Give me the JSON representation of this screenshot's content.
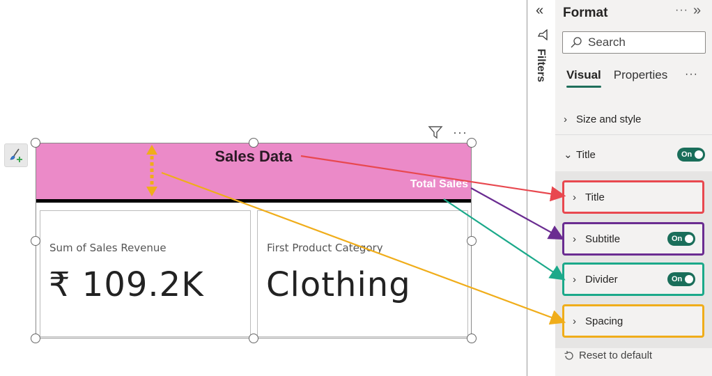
{
  "canvas": {
    "visual": {
      "title": "Sales Data",
      "subtitle": "Total Sales",
      "cards": [
        {
          "label": "Sum of Sales Revenue",
          "value": "₹ 109.2K"
        },
        {
          "label": "First Product Category",
          "value": "Clothing"
        }
      ],
      "header_icons": [
        "filter-icon",
        "more-options-icon"
      ],
      "more_label": "···"
    },
    "format_painter_icon": "paintbrush-plus-icon"
  },
  "filters_strip": {
    "collapse_icon": "«",
    "label": "Filters"
  },
  "format_pane": {
    "title": "Format",
    "more_label": "···",
    "expand_icon": "»",
    "search": {
      "placeholder": "Search"
    },
    "tabs": [
      {
        "label": "Visual",
        "active": true
      },
      {
        "label": "Properties",
        "active": false
      }
    ],
    "tabs_more": "···",
    "sections": {
      "size_and_style": {
        "label": "Size and style",
        "chevron": "›"
      },
      "title": {
        "label": "Title",
        "chevron": "⌄",
        "toggle": "On"
      }
    },
    "sub_sections": [
      {
        "label": "Title",
        "chevron": "›"
      },
      {
        "label": "Subtitle",
        "chevron": "›",
        "toggle": "On"
      },
      {
        "label": "Divider",
        "chevron": "›",
        "toggle": "On"
      },
      {
        "label": "Spacing",
        "chevron": "›"
      }
    ],
    "reset_label": "Reset to default"
  },
  "annotation_colors": {
    "title": "#e8484f",
    "subtitle": "#6a2c91",
    "divider": "#1ba98a",
    "spacing": "#f0ad1a"
  }
}
